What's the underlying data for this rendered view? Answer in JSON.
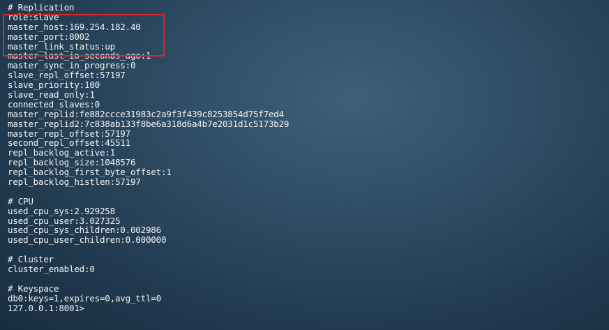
{
  "terminal": {
    "replication_header": "# Replication",
    "replication": [
      "role:slave",
      "master_host:169.254.182.40",
      "master_port:8002",
      "master_link_status:up",
      "master_last_io_seconds_ago:1",
      "master_sync_in_progress:0",
      "slave_repl_offset:57197",
      "slave_priority:100",
      "slave_read_only:1",
      "connected_slaves:0",
      "master_replid:fe882ccce31983c2a9f3f439c8253854d75f7ed4",
      "master_replid2:7c838ab133f8be6a318d6a4b7e2031d1c5173b29",
      "master_repl_offset:57197",
      "second_repl_offset:45511",
      "repl_backlog_active:1",
      "repl_backlog_size:1048576",
      "repl_backlog_first_byte_offset:1",
      "repl_backlog_histlen:57197"
    ],
    "cpu_header": "# CPU",
    "cpu": [
      "used_cpu_sys:2.929258",
      "used_cpu_user:3.027325",
      "used_cpu_sys_children:0.002986",
      "used_cpu_user_children:0.000000"
    ],
    "cluster_header": "# Cluster",
    "cluster": [
      "cluster_enabled:0"
    ],
    "keyspace_header": "# Keyspace",
    "keyspace": [
      "db0:keys=1,expires=0,avg_ttl=0"
    ],
    "prompt": "127.0.0.1:8001>"
  },
  "colors": {
    "highlight_border": "#d9262a",
    "text": "#f2f2f2"
  }
}
